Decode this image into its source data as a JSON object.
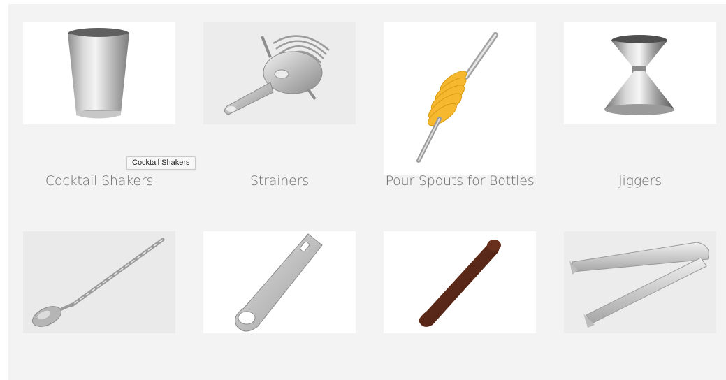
{
  "products": [
    {
      "label": "Cocktail Shakers",
      "icon": "cocktail-shaker-icon",
      "bg": "#ffffff"
    },
    {
      "label": "Strainers",
      "icon": "strainer-icon",
      "bg": "#ececec"
    },
    {
      "label": "Pour Spouts for Bottles",
      "icon": "pour-spout-icon",
      "bg": "#ffffff"
    },
    {
      "label": "Jiggers",
      "icon": "jigger-icon",
      "bg": "#ffffff"
    },
    {
      "label": "",
      "icon": "bar-spoon-icon",
      "bg": "#eaeaea"
    },
    {
      "label": "",
      "icon": "bottle-opener-icon",
      "bg": "#ffffff"
    },
    {
      "label": "",
      "icon": "muddler-icon",
      "bg": "#ffffff"
    },
    {
      "label": "",
      "icon": "ice-tongs-icon",
      "bg": "#ececec"
    }
  ],
  "tooltip": {
    "text": "Cocktail Shakers"
  },
  "colors": {
    "panel": "#f3f3f3",
    "label": "#6b6b6b",
    "spout_accent": "#f5b82e"
  }
}
